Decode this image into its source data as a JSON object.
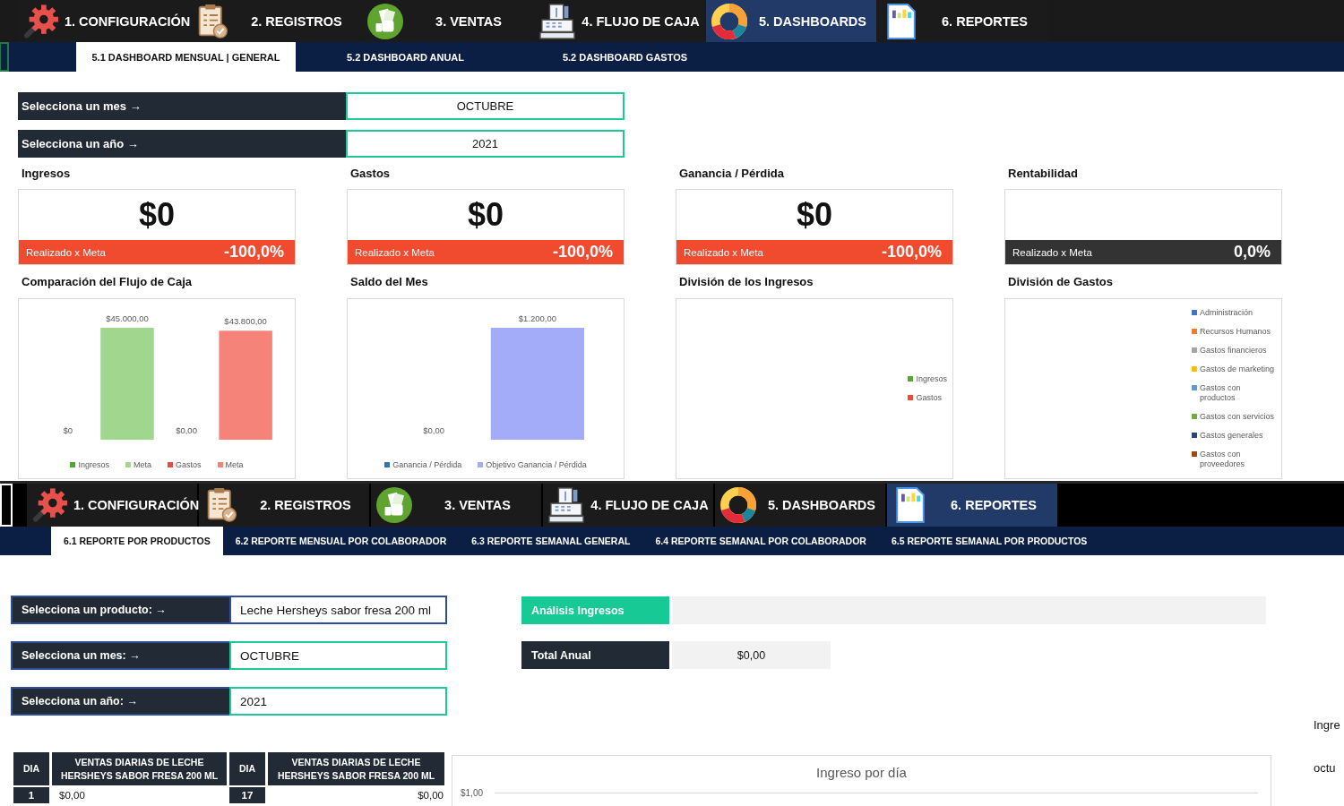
{
  "dashboard_view": {
    "nav": [
      {
        "label": "1. CONFIGURACIÓN",
        "kind": "gear",
        "selected": false
      },
      {
        "label": "2. REGISTROS",
        "kind": "clipboard",
        "selected": false
      },
      {
        "label": "3. VENTAS",
        "kind": "cash",
        "selected": false
      },
      {
        "label": "4. FLUJO DE CAJA",
        "kind": "register",
        "selected": false
      },
      {
        "label": "5. DASHBOARDS",
        "kind": "donut",
        "selected": true
      },
      {
        "label": "6. REPORTES",
        "kind": "report",
        "selected": false
      }
    ],
    "subtabs": [
      {
        "label": "5.1 DASHBOARD MENSUAL | GENERAL",
        "selected": true
      },
      {
        "label": "5.2 DASHBOARD ANUAL",
        "selected": false
      },
      {
        "label": "5.2 DASHBOARD GASTOS",
        "selected": false
      }
    ],
    "selectors": [
      {
        "label": "Selecciona un mes →",
        "value": "OCTUBRE"
      },
      {
        "label": "Selecciona un año →",
        "value": "2021"
      }
    ],
    "kpis": [
      {
        "title": "Ingresos",
        "value": "$0",
        "bar_label": "Realizado x Meta",
        "percent": "-100,0%",
        "color": "#f04a2f"
      },
      {
        "title": "Gastos",
        "value": "$0",
        "bar_label": "Realizado x Meta",
        "percent": "-100,0%",
        "color": "#f04a2f"
      },
      {
        "title": "Ganancia / Pérdida",
        "value": "$0",
        "bar_label": "Realizado x Meta",
        "percent": "-100,0%",
        "color": "#f04a2f"
      },
      {
        "title": "Rentabilidad",
        "bar_label": "Realizado x Meta",
        "percent": "0,0%",
        "color": "#333333"
      }
    ],
    "charts": [
      {
        "title": "Comparación del Flujo de Caja",
        "kind": "bars",
        "bars": [
          {
            "name": "Ingresos",
            "color": "#4ea72e",
            "value_label": "$0"
          },
          {
            "name": "Meta",
            "color": "#a1d68f",
            "value_label": "$45.000,00"
          },
          {
            "name": "Gastos",
            "color": "#e84c3d",
            "value_label": "$0,00"
          },
          {
            "name": "Meta",
            "color": "#f5837a",
            "value_label": "$43.800,00"
          }
        ]
      },
      {
        "title": "Saldo del Mes",
        "kind": "bars",
        "bars": [
          {
            "name": "Ganancia / Pérdida",
            "color": "#2e75b6",
            "value_label": "$0,00"
          },
          {
            "name": "Objetivo Ganancia / Pérdida",
            "color": "#a2acf8",
            "value_label": "$1.200,00"
          }
        ]
      },
      {
        "title": "División de los Ingresos",
        "kind": "empty",
        "legend": [
          {
            "name": "Ingresos",
            "color": "#5aa832"
          },
          {
            "name": "Gastos",
            "color": "#ee4b3b"
          }
        ]
      },
      {
        "title": "División de Gastos",
        "kind": "empty",
        "legend": [
          {
            "name": "Administración",
            "color": "#4472c4"
          },
          {
            "name": "Recursos Humanos",
            "color": "#ed7d31"
          },
          {
            "name": "Gastos financieros",
            "color": "#a5a5a5"
          },
          {
            "name": "Gastos de marketing",
            "color": "#ffc000"
          },
          {
            "name": "Gastos con productos",
            "color": "#5b9bd5"
          },
          {
            "name": "Gastos con servicios",
            "color": "#70ad47"
          },
          {
            "name": "Gastos generales",
            "color": "#264478"
          },
          {
            "name": "Gastos con proveedores",
            "color": "#9e480e"
          }
        ]
      }
    ]
  },
  "report_view": {
    "nav": [
      {
        "label": "1. CONFIGURACIÓN",
        "kind": "gear",
        "selected": false
      },
      {
        "label": "2. REGISTROS",
        "kind": "clipboard",
        "selected": false
      },
      {
        "label": "3. VENTAS",
        "kind": "cash",
        "selected": false
      },
      {
        "label": "4. FLUJO DE CAJA",
        "kind": "register",
        "selected": false
      },
      {
        "label": "5. DASHBOARDS",
        "kind": "donut",
        "selected": false
      },
      {
        "label": "6. REPORTES",
        "kind": "report",
        "selected": true
      }
    ],
    "subtabs": [
      {
        "label": "6.1 REPORTE POR PRODUCTOS",
        "selected": true
      },
      {
        "label": "6.2 REPORTE MENSUAL POR COLABORADOR",
        "selected": false
      },
      {
        "label": "6.3 REPORTE SEMANAL GENERAL",
        "selected": false
      },
      {
        "label": "6.4 REPORTE SEMANAL POR COLABORADOR",
        "selected": false
      },
      {
        "label": "6.5 REPORTE SEMANAL POR PRODUCTOS",
        "selected": false
      }
    ],
    "selectors": [
      {
        "label": "Selecciona un producto: →",
        "value": "Leche Hersheys sabor fresa 200 ml",
        "color": "#2f4e9a"
      },
      {
        "label": "Selecciona un mes: →",
        "value": "OCTUBRE",
        "color": "#1fc997"
      },
      {
        "label": "Selecciona un año: →",
        "value": "2021",
        "color": "#1fc997"
      }
    ],
    "analysis": {
      "label": "Análisis Ingresos"
    },
    "total": {
      "label": "Total Anual",
      "value": "$0,00"
    },
    "table": {
      "columns": [
        "DIA",
        "VENTAS DIARIAS DE LECHE HERSHEYS SABOR FRESA 200 ML",
        "DIA",
        "VENTAS DIARIAS DE LECHE HERSHEYS SABOR FRESA 200 ML"
      ],
      "rows": [
        [
          "1",
          "$0,00",
          "17",
          "$0,00"
        ]
      ]
    },
    "chart": {
      "title": "Ingreso por día",
      "tick_labels": [
        "$1,00"
      ]
    },
    "side_texts": [
      "Ingre",
      "octu"
    ]
  }
}
